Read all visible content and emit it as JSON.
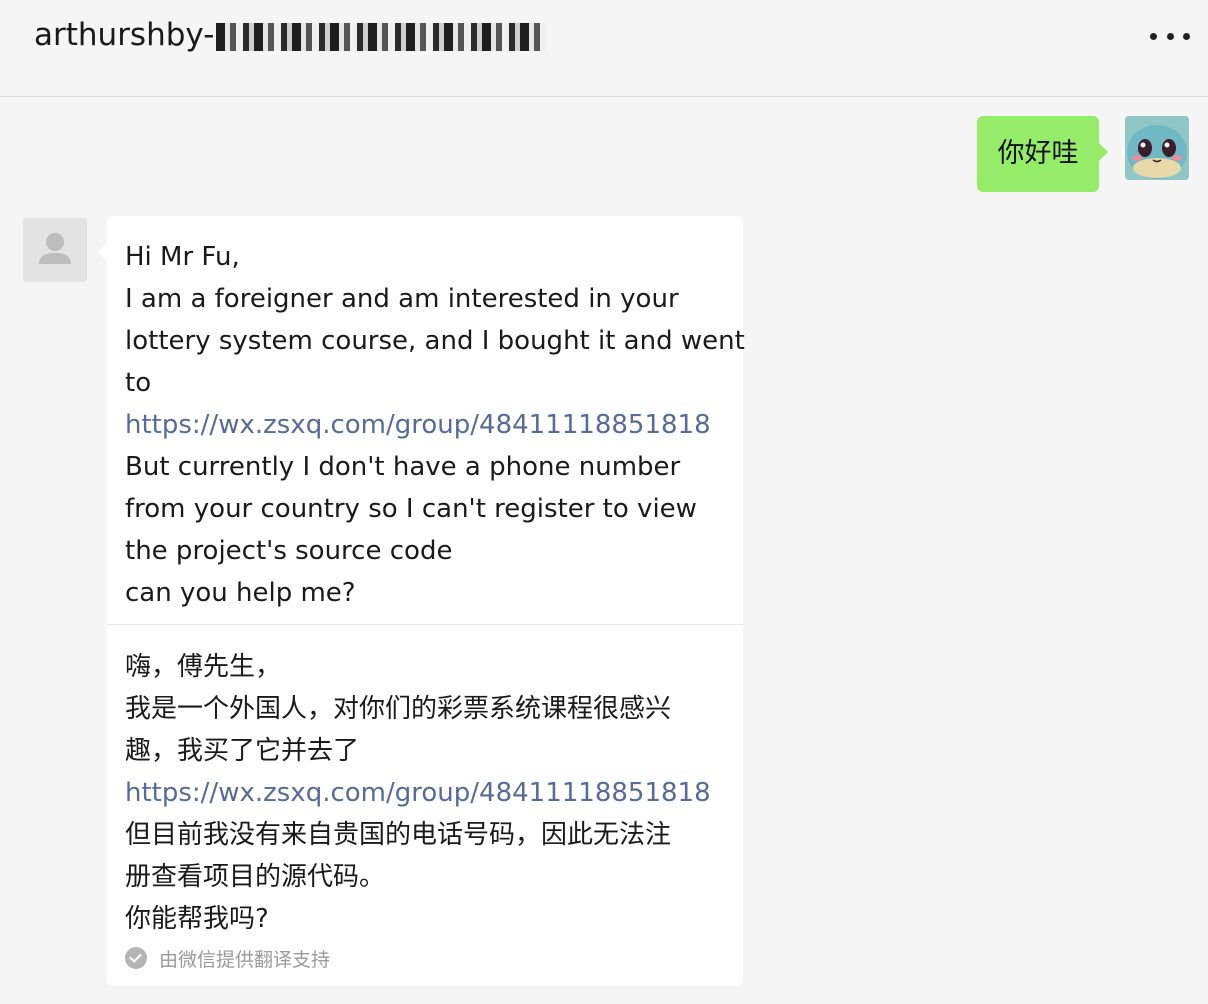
{
  "header": {
    "title": "arthurshby-",
    "redacted_label": "redacted"
  },
  "messages": {
    "outgoing": {
      "text": "你好哇"
    },
    "incoming": {
      "original_lines": [
        "Hi Mr Fu,",
        "I am a foreigner and am interested in your",
        "lottery system course, and I bought it and went",
        "to",
        "https://wx.zsxq.com/group/48411118851818",
        "But currently I don't have a phone number",
        "from your country so I can't register to view",
        "the project's source code",
        "can you help me?"
      ],
      "translation_lines": [
        "嗨，傅先生，",
        "我是一个外国人，对你们的彩票系统课程很感兴",
        "趣，我买了它并去了",
        "https://wx.zsxq.com/group/48411118851818",
        "但目前我没有来自贵国的电话号码，因此无法注",
        "册查看项目的源代码。",
        "你能帮我吗?"
      ],
      "translation_footer": "由微信提供翻译支持"
    }
  },
  "icons": {
    "more": "more-dots-icon",
    "check": "check-circle-icon",
    "default_avatar": "user-silhouette-icon"
  },
  "colors": {
    "outgoing_bubble": "#95ec69",
    "incoming_bubble": "#ffffff",
    "link": "#576b95",
    "background": "#f5f5f5"
  }
}
